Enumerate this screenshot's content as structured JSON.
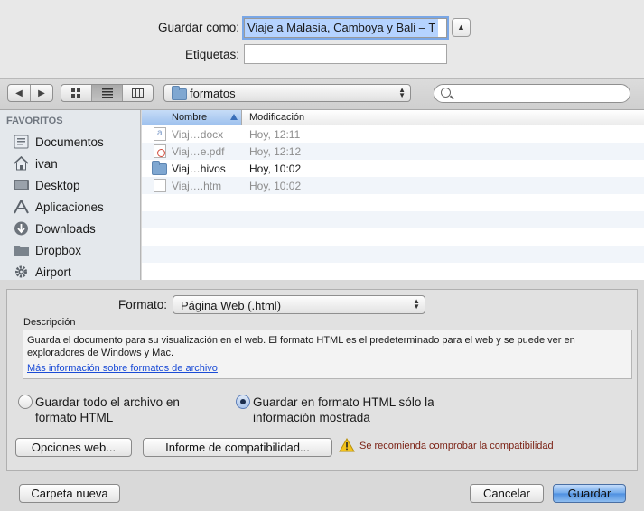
{
  "save": {
    "save_as_label": "Guardar como:",
    "filename": "Viaje a Malasia, Camboya y Bali – T",
    "tags_label": "Etiquetas:",
    "tags_value": ""
  },
  "toolbar": {
    "location": "formatos",
    "search_placeholder": ""
  },
  "sidebar": {
    "heading": "FAVORITOS",
    "items": [
      {
        "label": "Documentos",
        "icon": "documents-icon"
      },
      {
        "label": "ivan",
        "icon": "home-icon"
      },
      {
        "label": "Desktop",
        "icon": "desktop-icon"
      },
      {
        "label": "Aplicaciones",
        "icon": "applications-icon"
      },
      {
        "label": "Downloads",
        "icon": "downloads-icon"
      },
      {
        "label": "Dropbox",
        "icon": "folder-icon"
      },
      {
        "label": "Airport",
        "icon": "gear-icon"
      }
    ]
  },
  "files": {
    "columns": {
      "name": "Nombre",
      "modified": "Modificación"
    },
    "rows": [
      {
        "name": "Viaj…docx",
        "modified": "Hoy, 12:11",
        "type": "word"
      },
      {
        "name": "Viaj…e.pdf",
        "modified": "Hoy, 12:12",
        "type": "pdf"
      },
      {
        "name": "Viaj…hivos",
        "modified": "Hoy, 10:02",
        "type": "folder"
      },
      {
        "name": "Viaj….htm",
        "modified": "Hoy, 10:02",
        "type": "html"
      }
    ]
  },
  "options": {
    "format_label": "Formato:",
    "format_value": "Página Web (.html)",
    "description_label": "Descripción",
    "description_text": "Guarda el documento para su visualización en el web. El formato HTML es el predeterminado para el web y se puede ver en exploradores de Windows y Mac.",
    "description_link": "Más información sobre formatos de archivo",
    "radio_all_line1": "Guardar todo el archivo en",
    "radio_all_line2": "formato HTML",
    "radio_shown_line1": "Guardar en formato HTML sólo la",
    "radio_shown_line2": "información mostrada",
    "web_options_button": "Opciones web...",
    "compat_button": "Informe de compatibilidad...",
    "warning_text": "Se recomienda comprobar la compatibilidad"
  },
  "footer": {
    "new_folder": "Carpeta nueva",
    "cancel": "Cancelar",
    "save": "Guardar"
  }
}
